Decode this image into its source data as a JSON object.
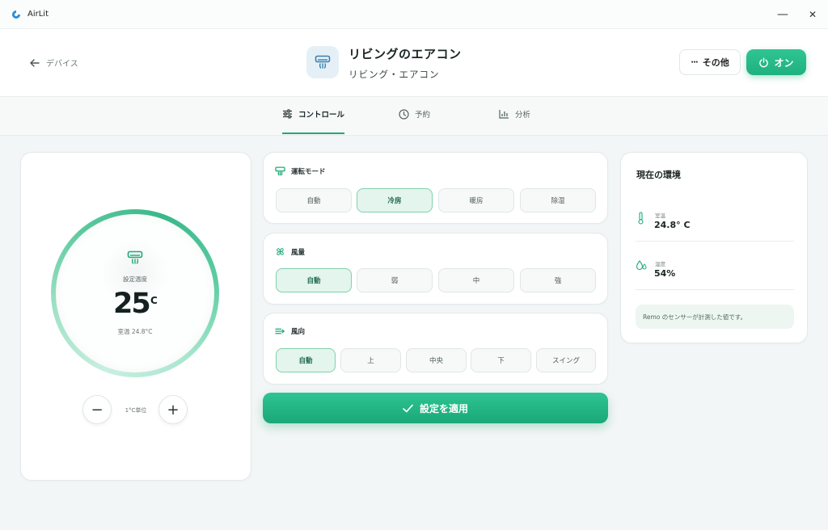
{
  "window": {
    "app_name": "AirLit",
    "minimize": "—",
    "close": "✕"
  },
  "header": {
    "back_label": "デバイス",
    "device_title": "リビングのエアコン",
    "device_subtitle": "リビング・エアコン",
    "more_label": "その他",
    "more_glyph": "···",
    "power_label": "オン"
  },
  "tabs": [
    {
      "label": "コントロール",
      "icon": "sliders-icon",
      "active": true
    },
    {
      "label": "予約",
      "icon": "clock-icon",
      "active": false
    },
    {
      "label": "分析",
      "icon": "bar-chart-icon",
      "active": false
    }
  ],
  "thermostat": {
    "set_label": "設定温度",
    "temperature": "25",
    "degree_mark": "°",
    "unit": "C",
    "room_label": "室温 24.8°C",
    "step_label": "1°C単位",
    "minus": "−",
    "plus": "+"
  },
  "mode": {
    "title": "運転モード",
    "options": [
      "自動",
      "冷房",
      "暖房",
      "除湿"
    ],
    "selected": "冷房"
  },
  "fan": {
    "title": "風量",
    "options": [
      "自動",
      "弱",
      "中",
      "強"
    ],
    "selected": "自動"
  },
  "direction": {
    "title": "風向",
    "options": [
      "自動",
      "上",
      "中央",
      "下",
      "スイング"
    ],
    "selected": "自動"
  },
  "apply_label": "設定を適用",
  "environment": {
    "title": "現在の環境",
    "room_temp_label": "室温",
    "room_temp_value": "24.8° C",
    "humidity_label": "湿度",
    "humidity_value": "54%",
    "note": "Remo のセンサーが計測した値です。"
  },
  "colors": {
    "accent": "#1fb07f",
    "accent_light": "#e4f5ed",
    "icon_blue": "#3a7fb0"
  }
}
